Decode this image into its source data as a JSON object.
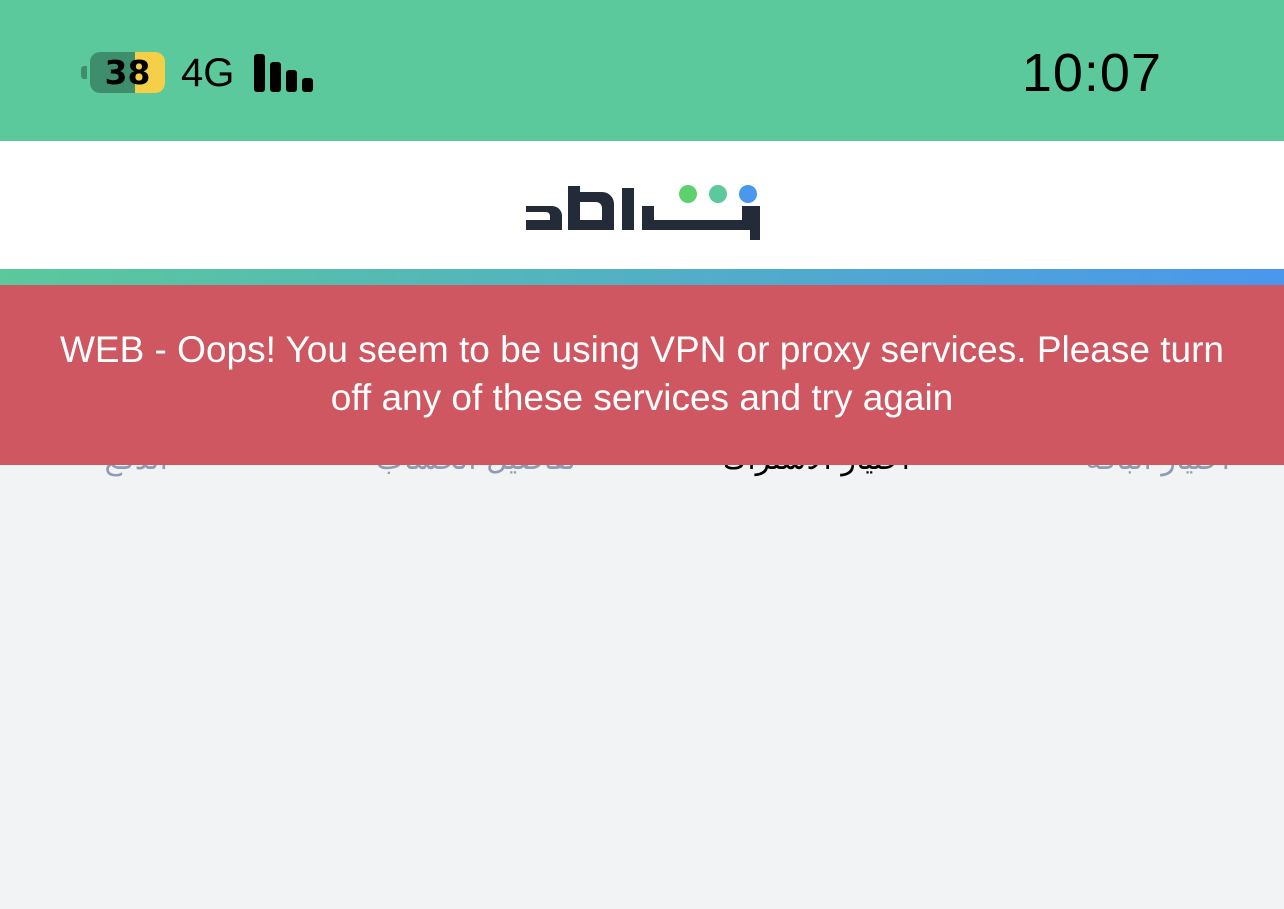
{
  "status_bar": {
    "battery_level": "38",
    "network": "4G",
    "time": "10:07",
    "background_color": "#5bc99b"
  },
  "header": {
    "logo_text": "شاهد",
    "logo_dot_colors": [
      "#5ed070",
      "#5bc99b",
      "#4a97ee"
    ],
    "logo_color": "#232b38"
  },
  "steps": [
    {
      "label": "اختيار الباقة",
      "active": false
    },
    {
      "label": "اختيار الاشتراك",
      "active": true
    },
    {
      "label": "تفاصيل الحساب",
      "active": false
    },
    {
      "label": "الدفع",
      "active": false
    }
  ],
  "alert": {
    "message": "WEB - Oops! You seem to be using VPN or proxy services. Please turn off any of these services and try again",
    "background_color": "#cf5761"
  }
}
